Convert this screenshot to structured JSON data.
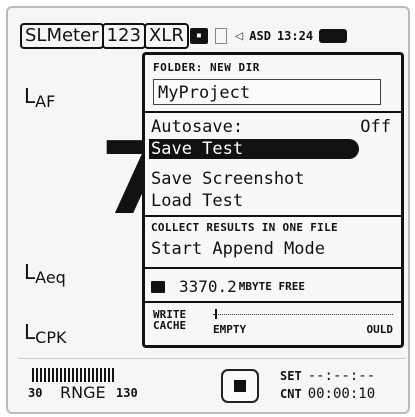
{
  "status_bar": {
    "mode_tab": "SLMeter",
    "numeric_tab": "123",
    "input_tab": "XLR",
    "profile": "ASD",
    "time": "13:24"
  },
  "measurements": {
    "laf_main": "L",
    "laf_sub": "AF",
    "laeq_main": "L",
    "laeq_sub": "Aeq",
    "lcpk_main": "L",
    "lcpk_sub": "CPK",
    "big_value": "7"
  },
  "menu": {
    "folder_label": "FOLDER: NEW DIR",
    "project_name": "MyProject",
    "autosave_label": "Autosave:",
    "autosave_value": "Off",
    "save_test": "Save Test",
    "save_screenshot": "Save Screenshot",
    "load_test": "Load Test",
    "collect_heading": "COLLECT RESULTS IN ONE FILE",
    "start_append": "Start Append Mode",
    "free_value": "3370.2",
    "free_unit": "MBYTE FREE",
    "cache_line1": "WRITE",
    "cache_line2": "CACHE",
    "cache_empty": "EMPTY",
    "cache_full": "OULD"
  },
  "bottom": {
    "range_low": "30",
    "range_name": "RNGE",
    "range_high": "130",
    "set_label": "SET",
    "set_value": "--:--:--",
    "cnt_label": "CNT",
    "cnt_value": "00:00:10"
  }
}
